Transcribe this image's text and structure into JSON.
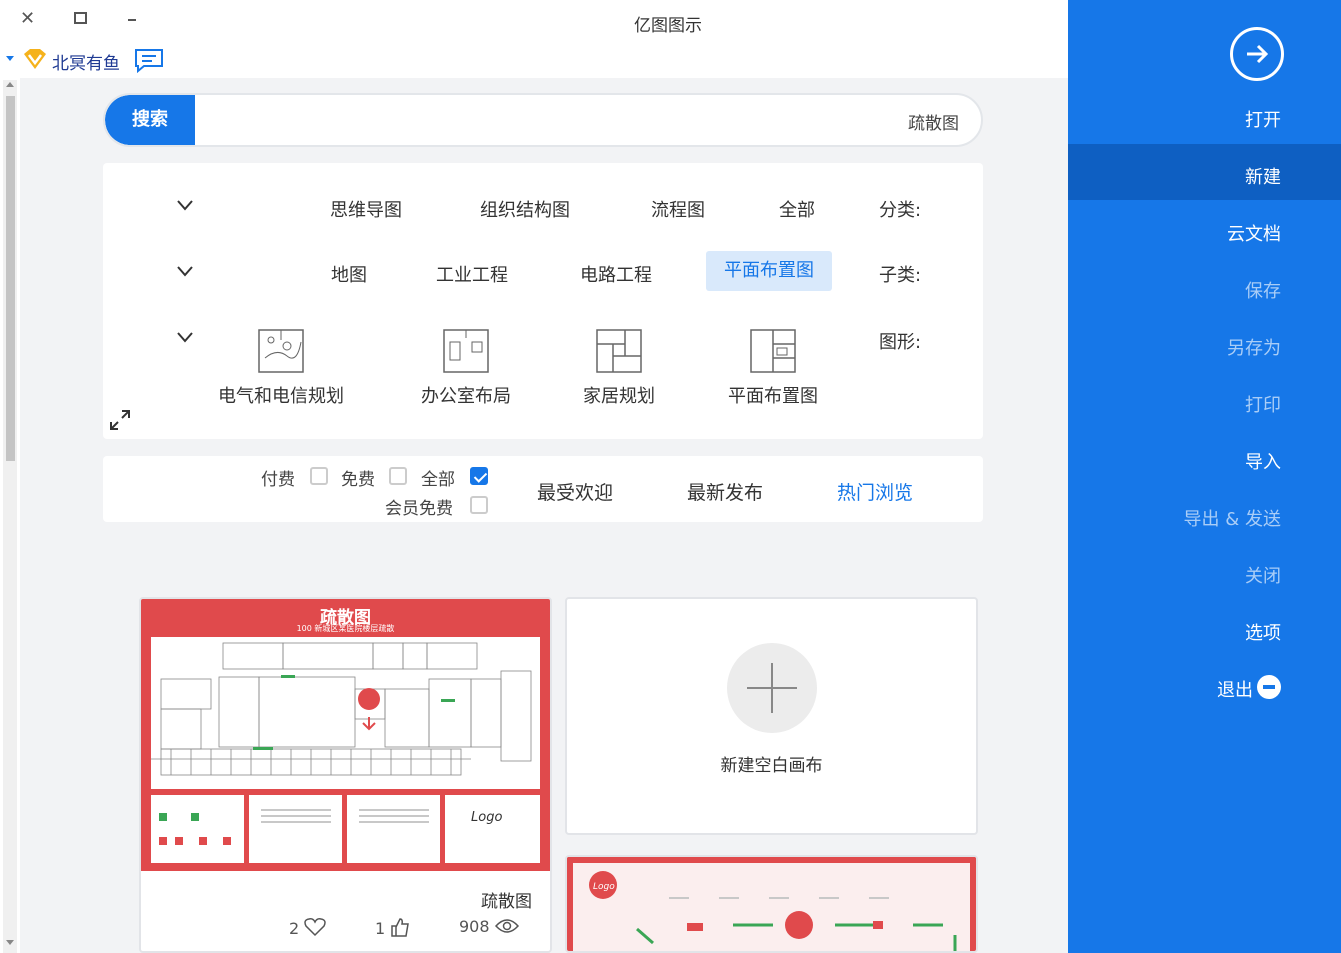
{
  "window": {
    "title": "亿图图示"
  },
  "user": {
    "name": "北冥有鱼"
  },
  "sidebar": {
    "items": [
      {
        "label": "打开"
      },
      {
        "label": "新建"
      },
      {
        "label": "云文档"
      },
      {
        "label": "保存"
      },
      {
        "label": "另存为"
      },
      {
        "label": "打印"
      },
      {
        "label": "导入"
      },
      {
        "label": "导出 & 发送"
      },
      {
        "label": "关闭"
      },
      {
        "label": "选项"
      },
      {
        "label": "退出"
      }
    ],
    "active_index": 1,
    "accent": "#1677e8"
  },
  "search": {
    "button_label": "搜索",
    "value": "疏散图"
  },
  "filters": {
    "category_label": "分类:",
    "categories": [
      "全部",
      "流程图",
      "组织结构图",
      "思维导图"
    ],
    "subcategory_label": "子类:",
    "subcategories": [
      "平面布置图",
      "电路工程",
      "工业工程",
      "地图"
    ],
    "active_subcategory": "平面布置图",
    "shapes_label": "图形:",
    "shapes": [
      "平面布置图",
      "家居规划",
      "办公室布局",
      "电气和电信规划"
    ]
  },
  "sort": {
    "tabs": [
      "热门浏览",
      "最新发布",
      "最受欢迎"
    ],
    "active_tab": "热门浏览",
    "checkboxes": [
      {
        "label": "全部",
        "checked": true
      },
      {
        "label": "免费",
        "checked": false
      },
      {
        "label": "付费",
        "checked": false
      },
      {
        "label": "会员免费",
        "checked": false
      }
    ]
  },
  "cards": {
    "template1": {
      "title": "疏散图",
      "thumb_title": "疏散图",
      "thumb_subtitle": "100 新城区某医院楼层疏散",
      "views": "908",
      "likes": "1",
      "favorites": "2"
    },
    "blank": {
      "label": "新建空白画布"
    }
  }
}
